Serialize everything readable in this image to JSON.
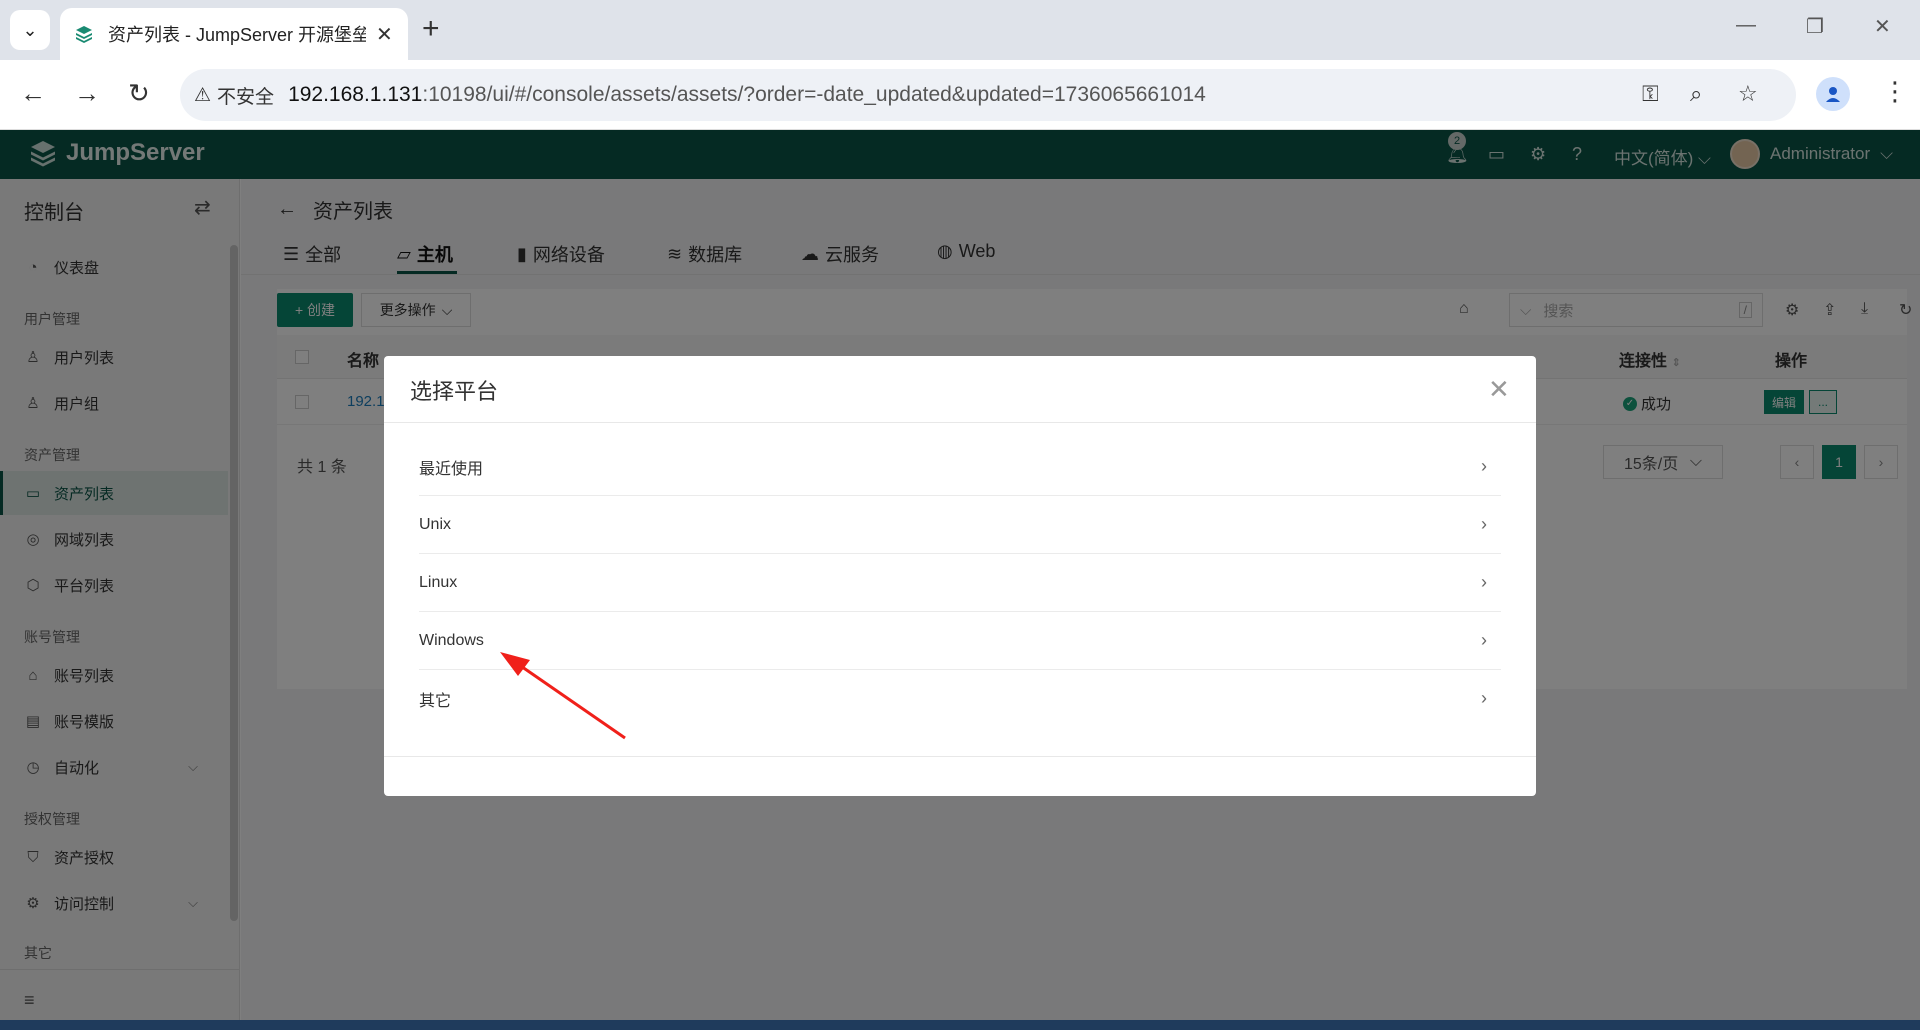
{
  "browser": {
    "tab_title": "资产列表 - JumpServer 开源堡垒机",
    "insecure_label": "不安全",
    "url_host": "192.168.1.131",
    "url_rest": ":10198/ui/#/console/assets/assets/?order=-date_updated&updated=1736065661014"
  },
  "header": {
    "logo": "JumpServer",
    "notification_count": "2",
    "language": "中文(简体)",
    "user": "Administrator",
    "colors": {
      "header_bg": "#0b5446",
      "primary": "#0b8a6e"
    }
  },
  "sidebar": {
    "title": "控制台",
    "dashboard": "仪表盘",
    "groups": {
      "users": "用户管理",
      "assets": "资产管理",
      "accounts": "账号管理",
      "perms": "授权管理",
      "other": "其它"
    },
    "items": {
      "user_list": "用户列表",
      "user_group": "用户组",
      "asset_list": "资产列表",
      "zone_list": "网域列表",
      "platform_list": "平台列表",
      "account_list": "账号列表",
      "account_template": "账号模版",
      "automation": "自动化",
      "asset_perm": "资产授权",
      "access_control": "访问控制"
    }
  },
  "main": {
    "breadcrumb": "资产列表",
    "tabs": [
      "全部",
      "主机",
      "网络设备",
      "数据库",
      "云服务",
      "Web"
    ],
    "active_tab": "主机",
    "create_label": "+ 创建",
    "more_label": "更多操作",
    "search_placeholder": "搜索",
    "search_shortcut": "/",
    "columns": {
      "name": "名称",
      "connectivity": "连接性",
      "actions": "操作"
    },
    "row": {
      "name": "192.1",
      "connectivity": "成功",
      "edit": "编辑",
      "more": "..."
    },
    "total": "共 1 条",
    "page_size": "15条/页",
    "current_page": "1"
  },
  "modal": {
    "title": "选择平台",
    "items": [
      "最近使用",
      "Unix",
      "Linux",
      "Windows",
      "其它"
    ]
  }
}
